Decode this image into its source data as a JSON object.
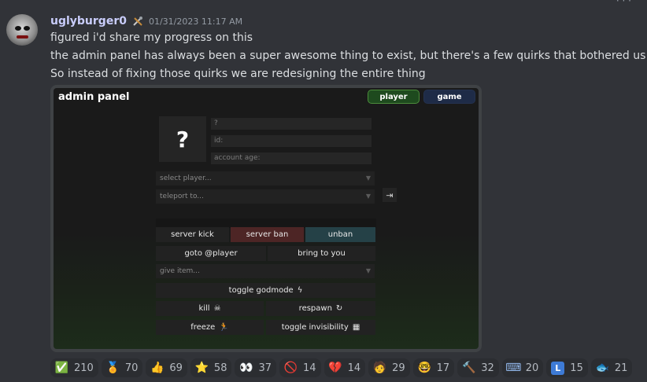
{
  "message": {
    "username": "uglyburger0",
    "timestamp": "01/31/2023 11:17 AM",
    "lines": [
      "figured i'd share my progress on this",
      "the admin panel has always been a super awesome thing to exist, but there's a few quirks that bothered us",
      "So instead of fixing those quirks we are redesigning the entire thing"
    ]
  },
  "panel": {
    "title": "admin panel",
    "tabs": {
      "player": "player",
      "game": "game"
    },
    "avatar_placeholder": "?",
    "info": {
      "name": "?",
      "id": "id:",
      "account_age": "account age:"
    },
    "select_player": "select player...",
    "teleport": "teleport to...",
    "buttons": {
      "server_kick": "server kick",
      "server_ban": "server ban",
      "unban": "unban",
      "goto_player": "goto @player",
      "bring_to_you": "bring to you",
      "give_item": "give item...",
      "toggle_godmode": "toggle godmode",
      "kill": "kill",
      "respawn": "respawn",
      "freeze": "freeze",
      "toggle_invisibility": "toggle invisibility"
    },
    "colors": {
      "player_tab": "#1e4a1e",
      "game_tab": "#1e2b47",
      "server_ban": "#4d2525",
      "unban": "#254147"
    }
  },
  "reactions": [
    {
      "icon": "check-mark-icon",
      "glyph": "✅",
      "count": "210"
    },
    {
      "icon": "medal-icon",
      "glyph": "🏅",
      "count": "70"
    },
    {
      "icon": "thumbs-up-icon",
      "glyph": "👍",
      "count": "69"
    },
    {
      "icon": "star-icon",
      "glyph": "⭐",
      "count": "58"
    },
    {
      "icon": "eyes-icon",
      "glyph": "👀",
      "count": "37"
    },
    {
      "icon": "no-entry-icon",
      "glyph": "🚫",
      "count": "14"
    },
    {
      "icon": "broken-heart-icon",
      "glyph": "💔",
      "count": "14"
    },
    {
      "icon": "custom-person-icon",
      "glyph": "🧑",
      "count": "29"
    },
    {
      "icon": "nerd-face-icon",
      "glyph": "🤓",
      "count": "17"
    },
    {
      "icon": "hammer-icon",
      "glyph": "🔨",
      "count": "32"
    },
    {
      "icon": "keyboard-icon",
      "glyph": "⌨",
      "count": "20"
    },
    {
      "icon": "letter-l-icon",
      "glyph": "L",
      "count": "15"
    },
    {
      "icon": "fish-icon",
      "glyph": "🐟",
      "count": "21"
    }
  ]
}
